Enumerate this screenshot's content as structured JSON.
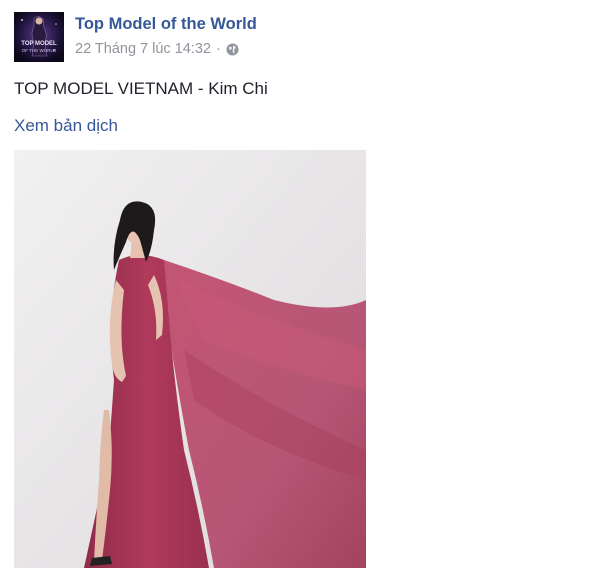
{
  "post": {
    "page_name": "Top Model of the World",
    "timestamp": "22 Tháng 7 lúc 14:32",
    "separator": "·",
    "privacy_icon": "globe-icon",
    "text": "TOP MODEL VIETNAM - Kim Chi",
    "translate_label": "Xem bản dịch",
    "avatar_logo_line1": "TOP MODEL",
    "avatar_logo_line2": "OF THE WORLD"
  },
  "colors": {
    "link": "#365899",
    "meta": "#90949c",
    "text": "#1d2129",
    "dress": "#b03a5b"
  }
}
